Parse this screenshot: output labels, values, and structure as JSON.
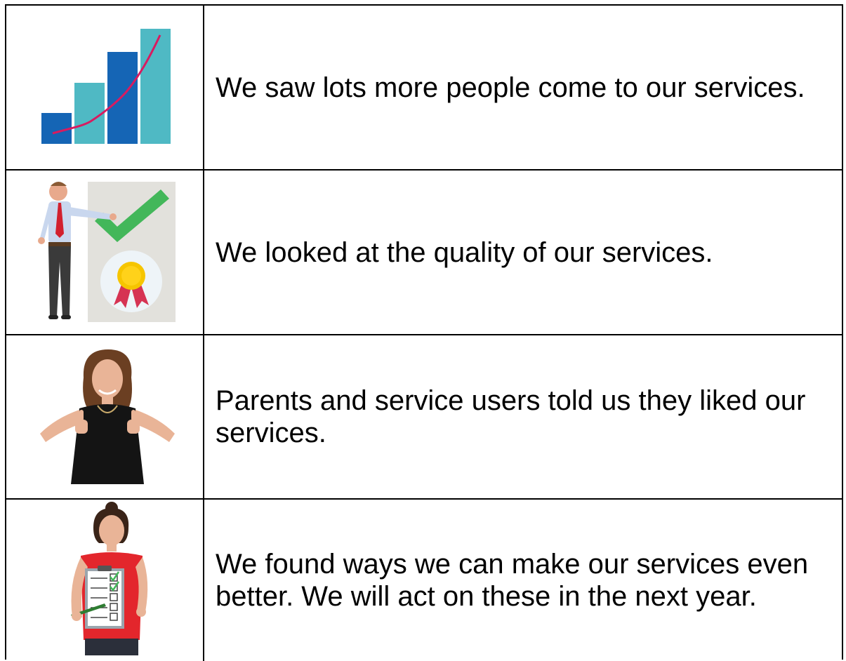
{
  "rows": [
    {
      "icon": "growth-bar-chart-icon",
      "text": "We saw lots more people come to our services."
    },
    {
      "icon": "quality-check-award-icon",
      "text": "We looked at the quality of our services."
    },
    {
      "icon": "thumbs-up-person-icon",
      "text": "Parents and service users told us they liked our services."
    },
    {
      "icon": "checklist-person-icon",
      "text": "We found ways we can make our services even better. We will act on these in the next year."
    }
  ],
  "colors": {
    "bar_dark": "#1565b5",
    "bar_light": "#4fb9c4",
    "trend_line": "#d81b60",
    "check_green": "#43b75a",
    "rosette_gold": "#f6c500",
    "rosette_red": "#d63353"
  }
}
